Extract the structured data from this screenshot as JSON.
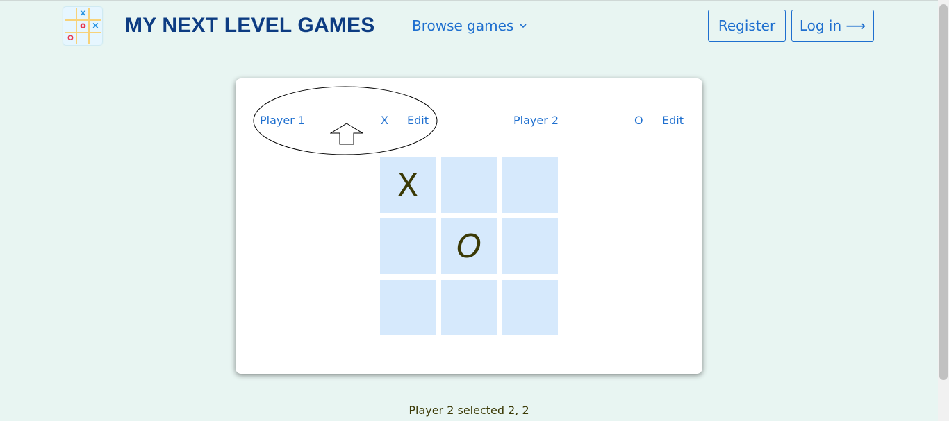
{
  "header": {
    "site_title": "MY NEXT LEVEL GAMES",
    "browse_label": "Browse games",
    "register_label": "Register",
    "login_label": "Log in ⟶",
    "logo_icon": "tic-tac-toe-logo-icon"
  },
  "players": {
    "p1": {
      "name": "Player 1",
      "symbol": "X",
      "edit": "Edit"
    },
    "p2": {
      "name": "Player 2",
      "symbol": "O",
      "edit": "Edit"
    }
  },
  "board": {
    "cells": [
      "X",
      "",
      "",
      "",
      "O",
      "",
      "",
      "",
      ""
    ]
  },
  "status": "Player 2 selected 2, 2",
  "colors": {
    "background": "#e8f5f2",
    "accent": "#1e6fcf",
    "title": "#0d3c82",
    "cell": "#d6e9fc",
    "mark": "#3b3a06"
  }
}
